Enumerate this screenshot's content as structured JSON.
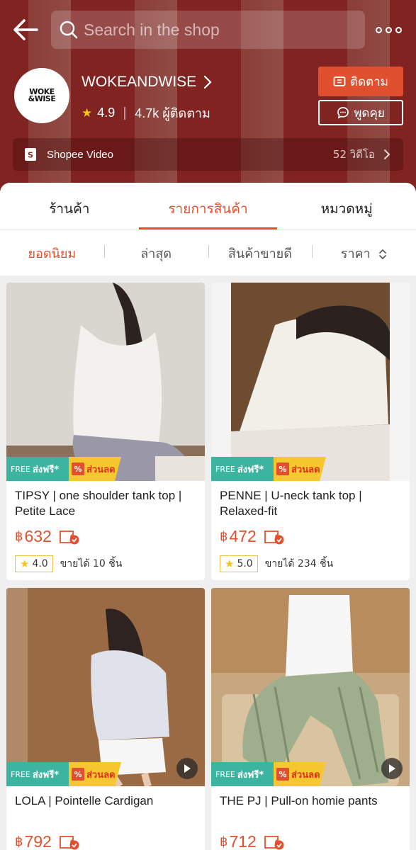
{
  "search": {
    "placeholder": "Search in the shop"
  },
  "shop": {
    "logo_text_top": "WOKE",
    "logo_text_bottom": "&WISE",
    "name": "WOKEANDWISE",
    "rating": "4.9",
    "followers": "4.7k ผู้ติดตาม",
    "follow_label": "ติดตาม",
    "chat_label": "พูดคุย"
  },
  "video_bar": {
    "label": "Shopee Video",
    "count": "52 วิดีโอ"
  },
  "tabs": [
    {
      "label": "ร้านค้า",
      "active": false
    },
    {
      "label": "รายการสินค้า",
      "active": true
    },
    {
      "label": "หมวดหมู่",
      "active": false
    }
  ],
  "sort": [
    {
      "label": "ยอดนิยม",
      "active": true
    },
    {
      "label": "ล่าสุด",
      "active": false
    },
    {
      "label": "สินค้าขายดี",
      "active": false
    },
    {
      "label": "ราคา",
      "active": false
    }
  ],
  "badges": {
    "free_small": "FREE",
    "free_big": "ส่งฟรี*",
    "sale": "ส่วนลด",
    "sale_icon": "%"
  },
  "products": [
    {
      "title": "TIPSY | one shoulder tank top | Petite Lace",
      "currency": "฿",
      "price": "632",
      "rating": "4.0",
      "sold": "ขายได้ 10 ชิ้น",
      "video": false
    },
    {
      "title": "PENNE | U-neck tank top | Relaxed-fit",
      "currency": "฿",
      "price": "472",
      "rating": "5.0",
      "sold": "ขายได้ 234 ชิ้น",
      "video": false
    },
    {
      "title": "LOLA | Pointelle Cardigan",
      "currency": "฿",
      "price": "792",
      "video": true
    },
    {
      "title": "THE PJ | Pull-on homie pants",
      "currency": "฿",
      "price": "712",
      "video": true
    }
  ],
  "colors": {
    "accent": "#e1502e",
    "header_bg": "#8e2a26",
    "free_badge": "#3cb4a0",
    "sale_badge": "#f7c72f"
  }
}
